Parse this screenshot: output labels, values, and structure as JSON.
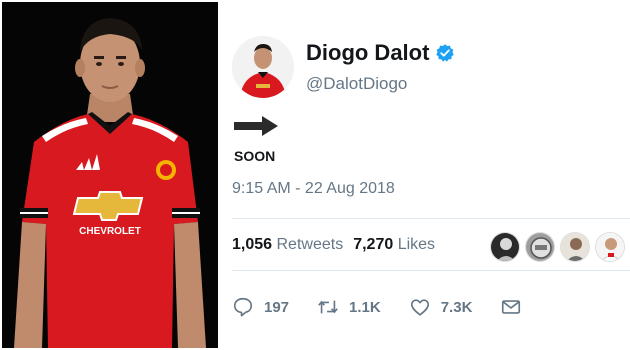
{
  "profile": {
    "display_name": "Diogo Dalot",
    "handle": "@DalotDiogo",
    "verified": true
  },
  "tweet": {
    "arrow_icon": "right-arrow-icon",
    "text": "SOON",
    "timestamp": "9:15 AM - 22 Aug 2018"
  },
  "stats": {
    "retweets_count": "1,056",
    "retweets_label": "Retweets",
    "likes_count": "7,270",
    "likes_label": "Likes"
  },
  "actions": {
    "reply_count": "197",
    "retweet_count": "1.1K",
    "like_count": "7.3K"
  },
  "photo": {
    "jersey_sponsor": "CHEVROLET"
  },
  "colors": {
    "verified_blue": "#1da1f2",
    "muted_text": "#657786",
    "jersey_red": "#d81a20"
  }
}
